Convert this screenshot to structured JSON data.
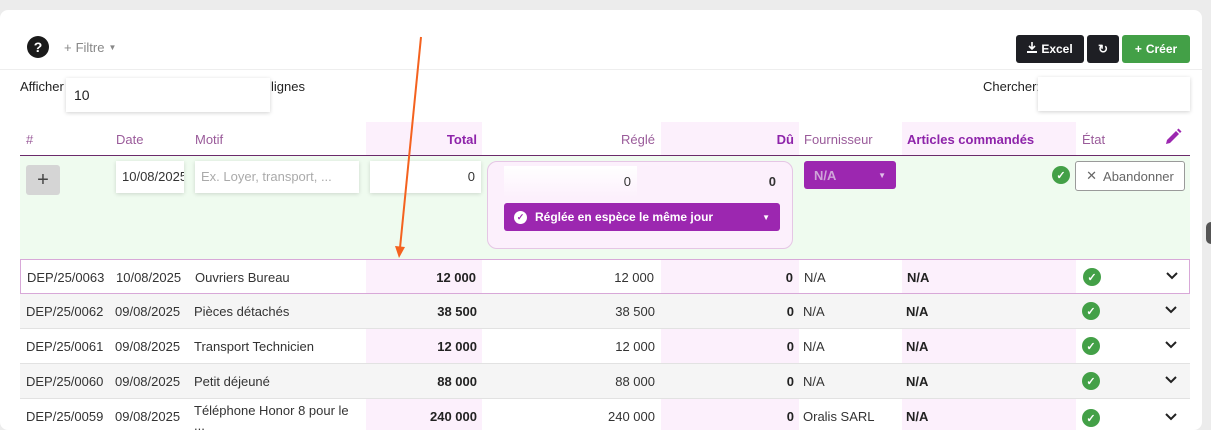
{
  "toolbar": {
    "help": "?",
    "filter": "Filtre",
    "excel": "Excel",
    "refresh": "↻",
    "create": "Créer"
  },
  "length": {
    "before": "Afficher",
    "value": "10",
    "after": "lignes"
  },
  "search": {
    "label": "Chercher:",
    "value": ""
  },
  "columns": {
    "num": "#",
    "date": "Date",
    "motif": "Motif",
    "total": "Total",
    "regle": "Réglé",
    "du": "Dû",
    "fournisseur": "Fournisseur",
    "articles": "Articles commandés",
    "etat": "État"
  },
  "new_row": {
    "add": "+",
    "date": "10/08/2025",
    "motif_placeholder": "Ex. Loyer, transport, ...",
    "total": "0",
    "regle": "0",
    "du": "0",
    "payment_mode": "Réglée en espèce le même jour",
    "fournisseur": "N/A",
    "abandon": "Abandonner"
  },
  "rows": [
    {
      "num": "DEP/25/0063",
      "date": "10/08/2025",
      "motif": "Ouvriers Bureau",
      "total": "12 000",
      "regle": "12 000",
      "du": "0",
      "fournisseur": "N/A",
      "articles": "N/A"
    },
    {
      "num": "DEP/25/0062",
      "date": "09/08/2025",
      "motif": "Pièces détachés",
      "total": "38 500",
      "regle": "38 500",
      "du": "0",
      "fournisseur": "N/A",
      "articles": "N/A"
    },
    {
      "num": "DEP/25/0061",
      "date": "09/08/2025",
      "motif": "Transport Technicien",
      "total": "12 000",
      "regle": "12 000",
      "du": "0",
      "fournisseur": "N/A",
      "articles": "N/A"
    },
    {
      "num": "DEP/25/0060",
      "date": "09/08/2025",
      "motif": "Petit déjeuné",
      "total": "88 000",
      "regle": "88 000",
      "du": "0",
      "fournisseur": "N/A",
      "articles": "N/A"
    },
    {
      "num": "DEP/25/0059",
      "date": "09/08/2025",
      "motif": "Téléphone Honor 8 pour le ...",
      "total": "240 000",
      "regle": "240 000",
      "du": "0",
      "fournisseur": "Oralis SARL",
      "articles": "N/A"
    }
  ],
  "icons": {
    "help": "question-icon",
    "filter": "plus-icon",
    "excel": "download-icon",
    "refresh": "refresh-icon",
    "create": "plus-icon",
    "edit": "pencil-icon",
    "status": "check-badge-icon",
    "expand": "chevron-down-icon",
    "annotation": "orange-arrow"
  },
  "colors": {
    "accent": "#9c27b0",
    "band": "#fcf0fc",
    "success": "#43a047",
    "annotation": "#f4621f"
  }
}
